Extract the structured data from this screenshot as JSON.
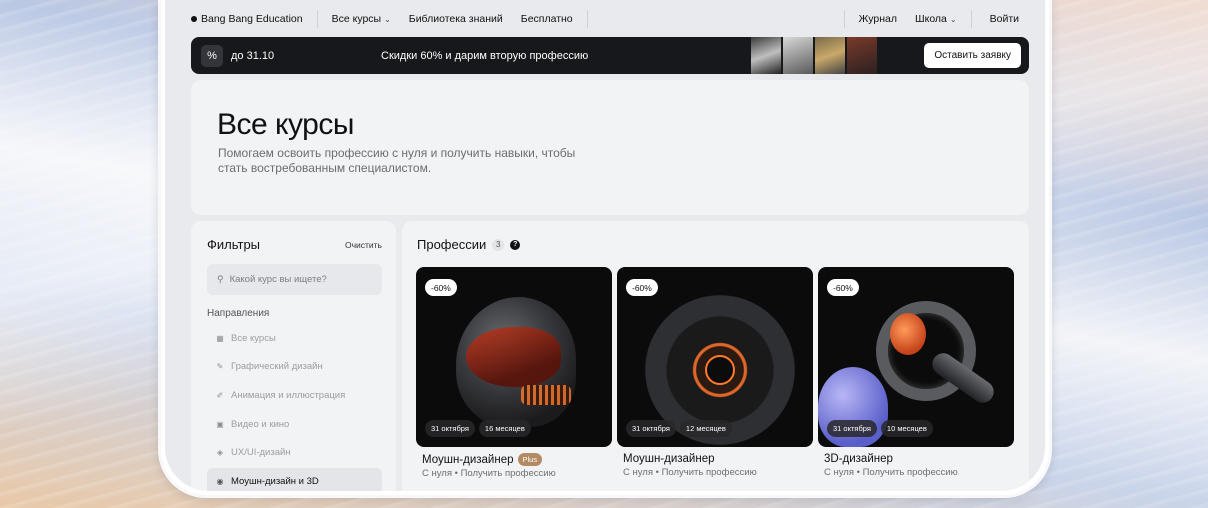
{
  "header": {
    "brand": "Bang Bang Education",
    "nav": [
      {
        "label": "Все курсы",
        "has_dropdown": true
      },
      {
        "label": "Библиотека знаний",
        "has_dropdown": false
      },
      {
        "label": "Бесплатно",
        "has_dropdown": false
      }
    ],
    "right_nav": [
      {
        "label": "Журнал",
        "has_dropdown": false
      },
      {
        "label": "Школа",
        "has_dropdown": true
      },
      {
        "label": "Войти",
        "has_dropdown": false
      }
    ]
  },
  "promo": {
    "badge": "%",
    "date": "до 31.10",
    "text": "Скидки 60% и дарим вторую профессию",
    "button": "Оставить заявку"
  },
  "hero": {
    "title": "Все курсы",
    "subtitle": "Помогаем освоить профессию с нуля и получить навыки, чтобы стать востребованным специалистом."
  },
  "filters": {
    "title": "Фильтры",
    "clear": "Очистить",
    "search_placeholder": "Какой курс вы ищете?",
    "directions_label": "Направления",
    "directions": [
      {
        "label": "Все курсы",
        "icon": "grid-icon",
        "active": false
      },
      {
        "label": "Графический дизайн",
        "icon": "pen-tool-icon",
        "active": false
      },
      {
        "label": "Анимация и иллюстрация",
        "icon": "brush-icon",
        "active": false
      },
      {
        "label": "Видео и кино",
        "icon": "play-icon",
        "active": false
      },
      {
        "label": "UX/UI-дизайн",
        "icon": "layers-icon",
        "active": false
      },
      {
        "label": "Моушн-дизайн и 3D",
        "icon": "motion-icon",
        "active": true
      }
    ]
  },
  "professions": {
    "title": "Профессии",
    "count": "3",
    "cards": [
      {
        "discount": "-60%",
        "date": "31 октября",
        "duration": "16 месяцев",
        "title": "Моушн-дизайнер",
        "badge": "Plus",
        "meta": "С нуля • Получить профессию"
      },
      {
        "discount": "-60%",
        "date": "31 октября",
        "duration": "12 месяцев",
        "title": "Моушн-дизайнер",
        "badge": "",
        "meta": "С нуля • Получить профессию"
      },
      {
        "discount": "-60%",
        "date": "31 октября",
        "duration": "10 месяцев",
        "title": "3D-дизайнер",
        "badge": "",
        "meta": "С нуля • Получить профессию"
      }
    ]
  }
}
